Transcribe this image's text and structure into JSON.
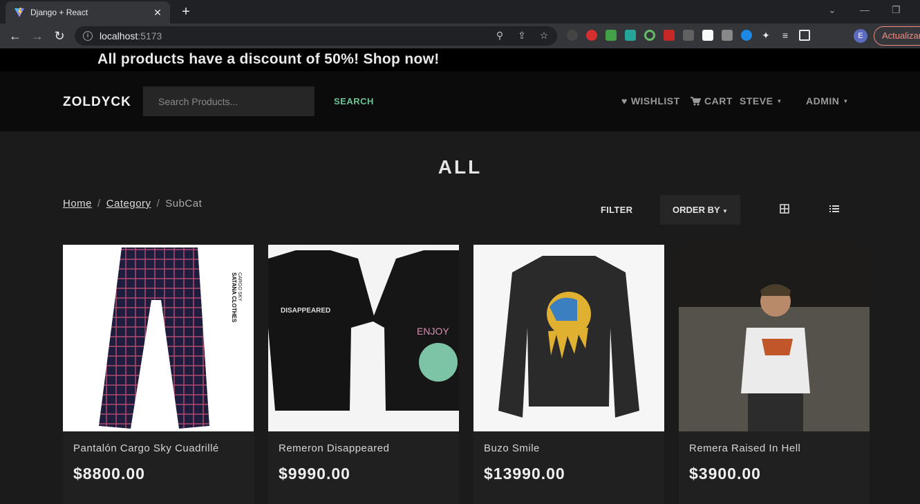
{
  "browser": {
    "tab_title": "Django + React",
    "url_host": "localhost",
    "url_port": ":5173",
    "profile_initial": "E",
    "update_label": "Actualizar"
  },
  "promo": {
    "text": "All products have a discount of 50%! Shop now!"
  },
  "navbar": {
    "brand": "ZOLDYCK",
    "search_placeholder": "Search Products...",
    "search_label": "SEARCH",
    "wishlist_label": "WISHLIST",
    "cart_label": "CART",
    "user_label": "STEVE",
    "admin_label": "ADMIN"
  },
  "page": {
    "heading": "ALL",
    "breadcrumb": [
      {
        "label": "Home",
        "link": true
      },
      {
        "label": "Category",
        "link": true
      },
      {
        "label": "SubCat",
        "link": false
      }
    ],
    "filter_label": "FILTER",
    "orderby_label": "ORDER BY"
  },
  "products": [
    {
      "name": "Pantalón Cargo Sky Cuadrillé",
      "price": "$8800.00",
      "image": "plaid-cargo-pants"
    },
    {
      "name": "Remeron Disappeared",
      "price": "$9990.00",
      "image": "black-tshirts"
    },
    {
      "name": "Buzo Smile",
      "price": "$13990.00",
      "image": "black-sweatshirt"
    },
    {
      "name": "Remera Raised In Hell",
      "price": "$3900.00",
      "image": "model-white-tee"
    }
  ],
  "colors": {
    "accent": "#6cc393",
    "background": "#1b1b1b",
    "navbar": "#0b0b0b"
  }
}
